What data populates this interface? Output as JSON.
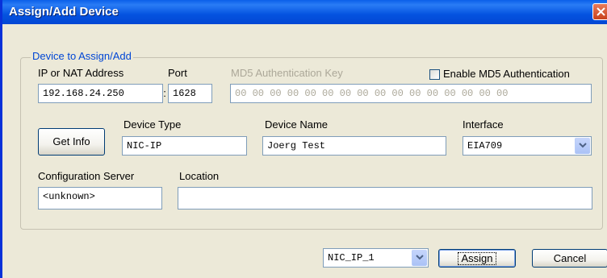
{
  "window": {
    "title": "Assign/Add Device"
  },
  "group": {
    "legend": "Device to Assign/Add"
  },
  "ip": {
    "label": "IP or NAT Address",
    "value": "192.168.24.250"
  },
  "port": {
    "label": "Port",
    "separator": ":",
    "value": "1628"
  },
  "md5": {
    "label": "MD5 Authentication Key",
    "value": "00 00 00 00 00 00 00 00 00 00 00 00 00 00 00 00",
    "enable_label": "Enable MD5 Authentication",
    "enabled": false
  },
  "get_info": {
    "label": "Get Info"
  },
  "device_type": {
    "label": "Device Type",
    "value": "NIC-IP"
  },
  "device_name": {
    "label": "Device Name",
    "value": "Joerg Test"
  },
  "interface": {
    "label": "Interface",
    "value": "EIA709"
  },
  "config_server": {
    "label": "Configuration Server",
    "value": "<unknown>"
  },
  "location": {
    "label": "Location",
    "value": ""
  },
  "footer": {
    "nic_select": "NIC_IP_1",
    "assign_label": "Assign",
    "cancel_label": "Cancel"
  },
  "colors": {
    "title_bar": "#0453e0",
    "window_bg": "#ece9d8",
    "legend_text": "#0046d5",
    "close_button": "#d6552f"
  },
  "icons": {
    "close": "close-x-icon",
    "dropdown": "chevron-down-icon"
  }
}
